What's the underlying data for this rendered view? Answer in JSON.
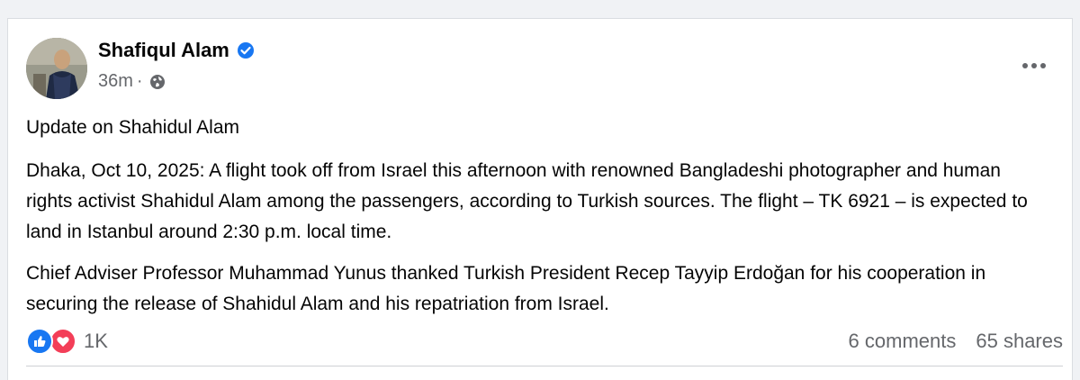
{
  "post": {
    "author": "Shafiqul Alam",
    "verified": true,
    "timestamp": "36m",
    "separator": "·",
    "audience_icon": "globe-icon",
    "menu_icon": "more-options-icon",
    "paragraphs": [
      "Update on Shahidul Alam",
      "Dhaka, Oct 10, 2025: A flight took off from Israel this afternoon with renowned Bangladeshi photographer and human rights activist Shahidul Alam among the passengers, according to Turkish sources. The flight – TK 6921 – is expected to land in Istanbul around 2:30 p.m. local time.",
      "Chief Adviser Professor Muhammad Yunus thanked Turkish President Recep Tayyip Erdoğan for his cooperation in securing the release of Shahidul Alam and his repatriation from Israel."
    ]
  },
  "engagement": {
    "reaction_icons": [
      "like-icon",
      "love-icon"
    ],
    "reaction_count": "1K",
    "comments": "6 comments",
    "shares": "65 shares"
  },
  "colors": {
    "like": "#1877f2",
    "love": "#f33e58",
    "verified": "#1877f2",
    "secondary_text": "#65676b"
  }
}
